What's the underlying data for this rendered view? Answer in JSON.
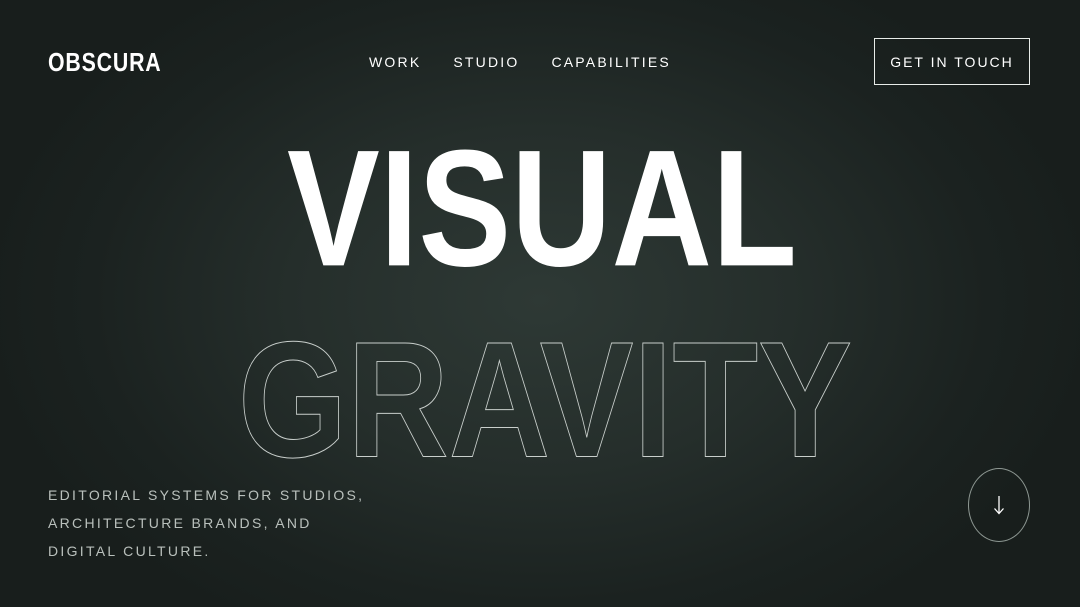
{
  "brand": {
    "logo": "OBSCURA"
  },
  "nav": {
    "items": [
      {
        "label": "WORK"
      },
      {
        "label": "STUDIO"
      },
      {
        "label": "CAPABILITIES"
      }
    ],
    "cta_label": "GET IN TOUCH"
  },
  "hero": {
    "headline_primary": "VISUAL",
    "headline_secondary": "GRAVITY",
    "tagline": "EDITORIAL SYSTEMS FOR STUDIOS, ARCHITECTURE BRANDS, AND DIGITAL CULTURE.",
    "scroll_icon": "arrow-down-icon"
  },
  "colors": {
    "background": "#1c2320",
    "text": "#ffffff",
    "muted_text": "#b9c0bc",
    "outline_text": "#c9cfcc"
  }
}
